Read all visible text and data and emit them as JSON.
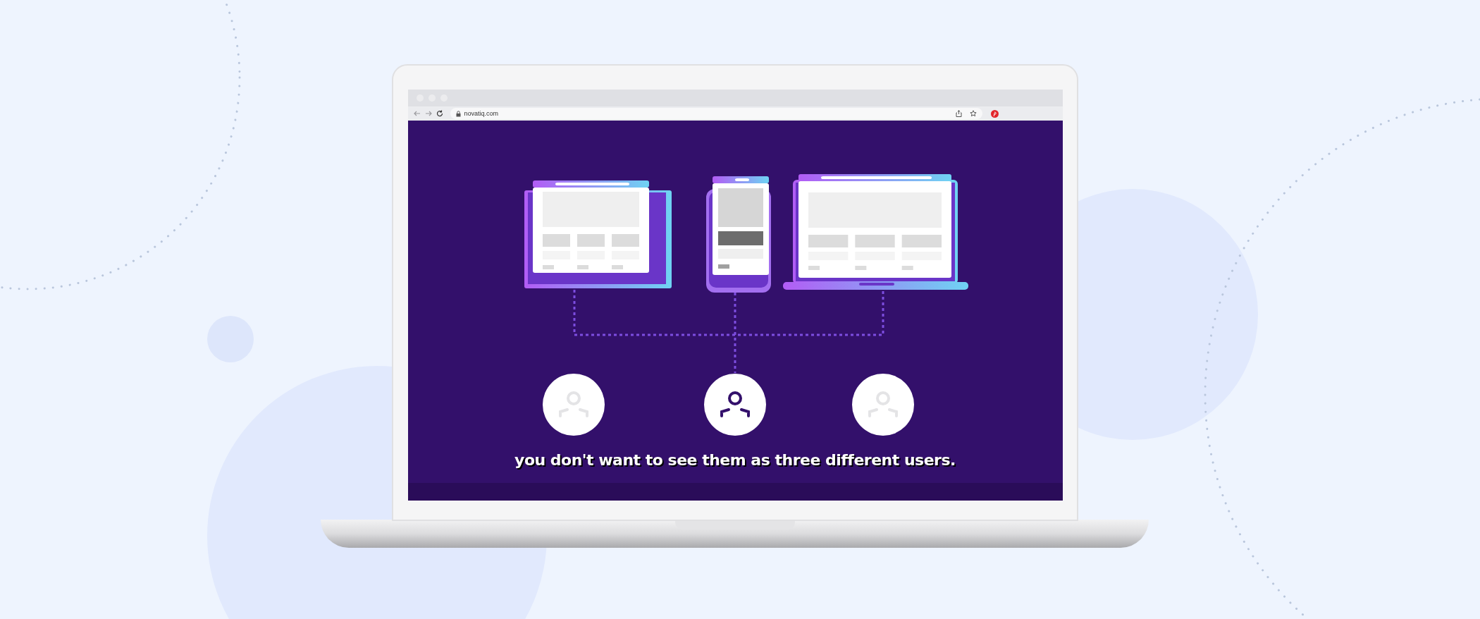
{
  "browser": {
    "url": "novatiq.com"
  },
  "video": {
    "caption": "you don't want to see them as three different users.",
    "users": [
      {
        "selected": false
      },
      {
        "selected": true
      },
      {
        "selected": false
      }
    ]
  }
}
